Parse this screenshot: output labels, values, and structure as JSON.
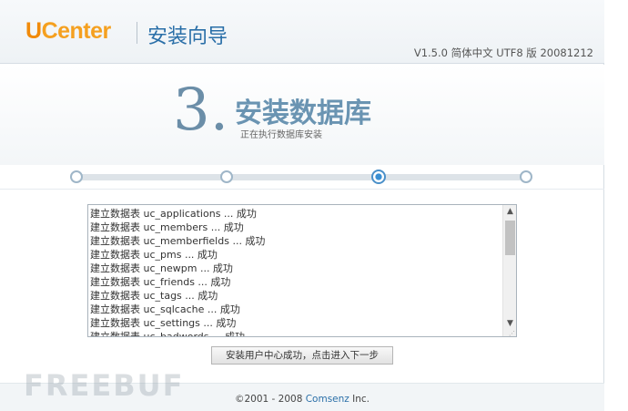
{
  "header": {
    "logo_u": "U",
    "logo_rest": "Center",
    "wizard_title": "安装向导",
    "version": "V1.5.0 简体中文 UTF8 版 20081212"
  },
  "step": {
    "number": "3.",
    "title": "安装数据库",
    "subtitle": "正在执行数据库安装",
    "total_steps": 4,
    "current_step": 3
  },
  "log": {
    "lines": [
      "建立数据表 uc_applications ... 成功",
      "建立数据表 uc_members ... 成功",
      "建立数据表 uc_memberfields ... 成功",
      "建立数据表 uc_pms ... 成功",
      "建立数据表 uc_newpm ... 成功",
      "建立数据表 uc_friends ... 成功",
      "建立数据表 uc_tags ... 成功",
      "建立数据表 uc_sqlcache ... 成功",
      "建立数据表 uc_settings ... 成功",
      "建立数据表 uc_badwords ... 成功"
    ]
  },
  "next_button": {
    "label": "安装用户中心成功，点击进入下一步"
  },
  "footer": {
    "prefix": "©2001 - 2008 ",
    "brand": "Comsenz",
    "suffix": " Inc."
  },
  "watermark": {
    "text": "FREEBUF"
  },
  "colors": {
    "logo_orange": "#f18a0a",
    "title_blue": "#2a6fa8",
    "step_blue": "#6a94b2",
    "active_node": "#3a8fd3"
  },
  "icons": {
    "scroll_up": "chevron-up-icon",
    "scroll_down": "chevron-down-icon",
    "resize": "resize-grip-icon"
  }
}
